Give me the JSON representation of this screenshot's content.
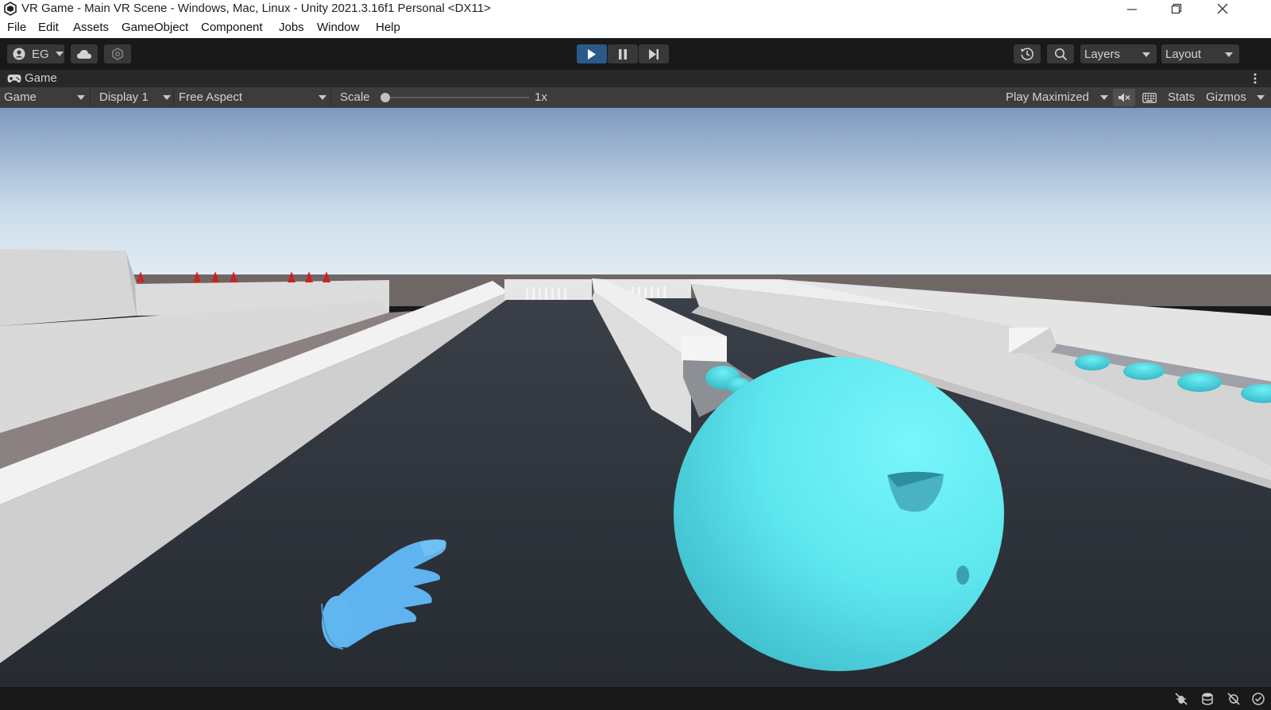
{
  "window": {
    "title": "VR Game - Main VR Scene - Windows, Mac, Linux - Unity 2021.3.16f1 Personal <DX11>"
  },
  "menu": [
    "File",
    "Edit",
    "Assets",
    "GameObject",
    "Component",
    "Jobs",
    "Window",
    "Help"
  ],
  "toolbar": {
    "account_label": "EG",
    "layers_label": "Layers",
    "layout_label": "Layout",
    "play_active": true
  },
  "tab": {
    "label": "Game"
  },
  "gamebar": {
    "mode": "Game",
    "display": "Display 1",
    "aspect": "Free Aspect",
    "scale_label": "Scale",
    "scale_value": "1x",
    "play_mode": "Play Maximized",
    "stats_label": "Stats",
    "gizmos_label": "Gizmos"
  },
  "colors": {
    "play_active": "#2a5a8a",
    "ball": "#5ee8ee",
    "hand": "#5fb3ee",
    "floor": "#2f333b",
    "lane_wall": "#d9d9d9",
    "pins_red": "#cc2222"
  },
  "icons": {
    "account": "account-icon",
    "cloud": "cloud-icon",
    "collab": "collab-icon",
    "history": "history-icon",
    "search": "search-icon",
    "mute": "mute-audio-icon",
    "shortcuts": "keyboard-icon"
  }
}
